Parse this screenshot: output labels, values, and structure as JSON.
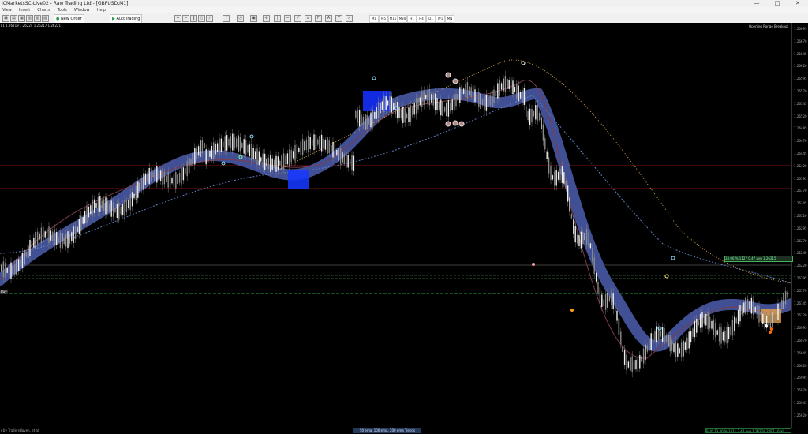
{
  "window": {
    "title": "ICMarketsSC-Live02 - Raw Trading Ltd - [GBPUSD,M1]",
    "minimize": "—",
    "maximize": "□",
    "close": "✕"
  },
  "menu": [
    "View",
    "Insert",
    "Charts",
    "Tools",
    "Window",
    "Help"
  ],
  "toolbar": {
    "new_order": "New Order",
    "autotrading": "AutoTrading",
    "timeframes": [
      "M1",
      "M5",
      "M15",
      "M30",
      "H1",
      "H4",
      "D1",
      "W1",
      "MN"
    ]
  },
  "chart": {
    "header": "F1  1.26219  1.26224  1.26217  1.26221",
    "indicator": "Opening Range Breakout",
    "left_flag": "Buy",
    "trade_label": "33.00  %  1127  0.47  avg  1.26215",
    "bottom_left": "r by TradersHaven, et al",
    "bottom_center": "50 ema, 100 ema, 200 ema Trends",
    "bottom_right": "BUY: 13 00 % 1411  3.44  avg  1.26218  2797.16  all  ...",
    "price_labels": [
      "1.26695",
      "1.26670",
      "1.26645",
      "1.26620",
      "1.26595",
      "1.26570",
      "1.26545",
      "1.26520",
      "1.26495",
      "1.26470",
      "1.26445",
      "1.26420",
      "1.26395",
      "1.26370",
      "1.26345",
      "1.26320",
      "1.26295",
      "1.26270",
      "1.26245",
      "1.26220",
      "1.26195",
      "1.26170",
      "1.26145",
      "1.26120",
      "1.26095",
      "1.26070",
      "1.26045",
      "1.26020",
      "1.25995",
      "1.25970",
      "1.25945",
      "1.25920"
    ]
  },
  "icons": {
    "new_order": "order-icon",
    "autotrading": "autotrading-icon",
    "zoom_in": "zoom-in-icon",
    "zoom_out": "zoom-out-icon",
    "crosshair": "crosshair-icon"
  },
  "colors": {
    "background": "#000000",
    "band": "#3f4f9a",
    "candle_up": "#f0f0f0",
    "candle_down": "#8b8b8b",
    "accent_green": "#36d36d",
    "accent_red": "#b81f1f"
  }
}
